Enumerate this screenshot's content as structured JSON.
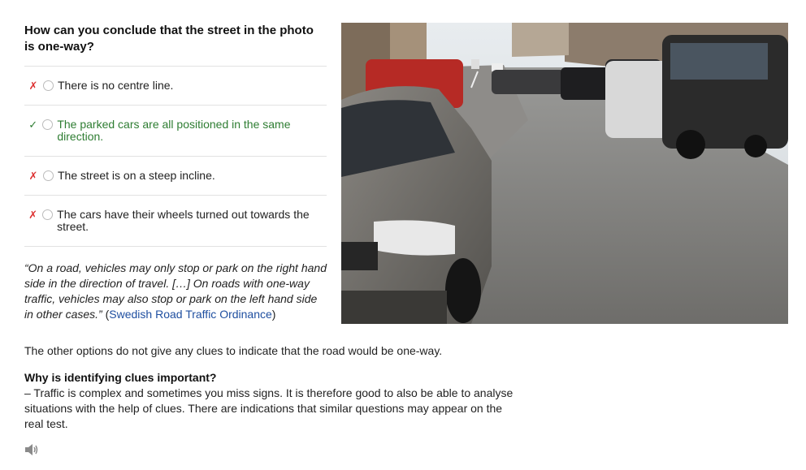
{
  "question": "How can you conclude that the street in the photo is one-way?",
  "options": [
    {
      "label": "There is no centre line.",
      "mark": "✗"
    },
    {
      "label": "The parked cars are all positioned in the same direction.",
      "mark": "✓"
    },
    {
      "label": "The street is on a steep incline.",
      "mark": "✗"
    },
    {
      "label": "The cars have their wheels turned out towards the street.",
      "mark": "✗"
    }
  ],
  "quote": {
    "text": "“On a road, vehicles may only stop or park on the right hand side in the direction of travel. […] On roads with one-way traffic, vehicles may also stop or park on the left hand side in other cases.”",
    "open_paren": "(",
    "link": "Swedish Road Traffic Ordinance",
    "close_paren": ")"
  },
  "explanation": "The other options do not give any clues to indicate that the road would be one-way.",
  "why": {
    "title": "Why is identifying clues important?",
    "text": "– Traffic is complex and sometimes you miss signs. It is therefore good to also be able to analyse situations with the help of clues. There are indications that similar questions may appear on the real test."
  },
  "colors": {
    "correct": "#2e7d32",
    "wrong": "#dd3333",
    "link": "#1f4fa0"
  },
  "icons": {
    "audio": "speaker-icon"
  }
}
